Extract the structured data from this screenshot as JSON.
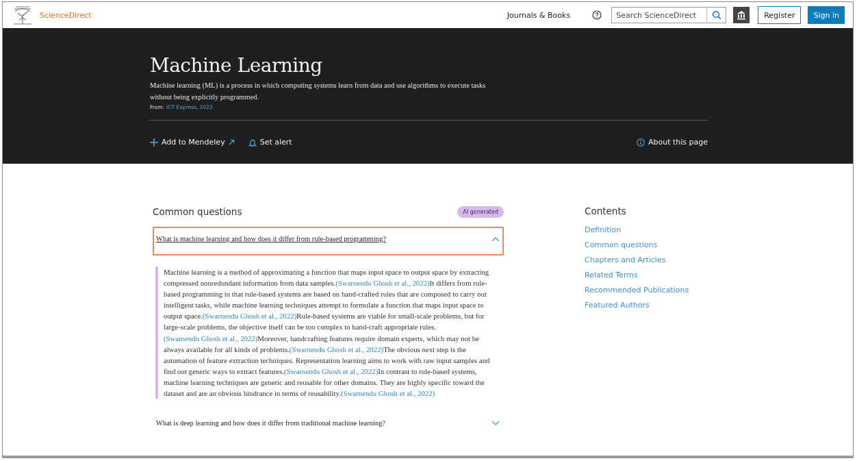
{
  "header": {
    "brand": "ScienceDirect",
    "nav_link": "Journals & Books",
    "search": {
      "placeholder": "Search ScienceDirect"
    },
    "register": "Register",
    "sign_in": "Sign in"
  },
  "topic": {
    "title": "Machine Learning",
    "definition": "Machine learning (ML) is a process in which computing systems learn from data and use algorithms to execute tasks without being explicitly programmed.",
    "source_label": "From:",
    "source": "ICT Express, 2022",
    "actions": [
      "Add to Mendeley",
      "Set alert"
    ],
    "about": "About this page"
  },
  "common_questions": {
    "heading": "Common questions",
    "badge": "AI generated",
    "questions": [
      {
        "question": "What is machine learning and how does it differ from rule-based programming?",
        "expanded": true,
        "answer": [
          {
            "kind": "text",
            "text": "Machine learning is a method of approximating a function that maps input space to output space by extracting compressed nonredundant information from data samples."
          },
          {
            "kind": "cite",
            "text": "(Swarnendu Ghosh et al., 2022)"
          },
          {
            "kind": "text",
            "text": "It differs from rule-based programming in that rule-based systems are based on hand-crafted rules that are composed to carry out intelligent tasks, while machine learning techniques attempt to formulate a function that maps input space to output space."
          },
          {
            "kind": "cite",
            "text": "(Swarnendu Ghosh et al., 2022)"
          },
          {
            "kind": "text",
            "text": "Rule-based systems are viable for small-scale problems, but for large-scale problems, the objective itself can be too complex to hand-craft appropriate rules."
          },
          {
            "kind": "cite",
            "text": "(Swarnendu Ghosh et al., 2022)"
          },
          {
            "kind": "text",
            "text": "Moreover, handcrafting features require domain experts, which may not be always available for all kinds of problems."
          },
          {
            "kind": "cite",
            "text": "(Swarnendu Ghosh et al., 2022)"
          },
          {
            "kind": "text",
            "text": "The obvious next step is the automation of feature extraction techniques. Representation learning aims to work with raw input samples and find out generic ways to extract features."
          },
          {
            "kind": "cite",
            "text": "(Swarnendu Ghosh et al., 2022)"
          },
          {
            "kind": "text",
            "text": "In contrast to rule-based systems, machine learning techniques are generic and reusable for other domains. They are highly specific toward the dataset and are an obvious hindrance in terms of reusability."
          },
          {
            "kind": "cite",
            "text": "(Swarnendu Ghosh et al., 2022)"
          }
        ]
      },
      {
        "question": "What is deep learning and how does it differ from traditional machine learning?",
        "expanded": false
      }
    ]
  },
  "contents": {
    "heading": "Contents",
    "items": [
      "Definition",
      "Common questions",
      "Chapters and Articles",
      "Related Terms",
      "Recommended Publications",
      "Featured Authors"
    ]
  }
}
